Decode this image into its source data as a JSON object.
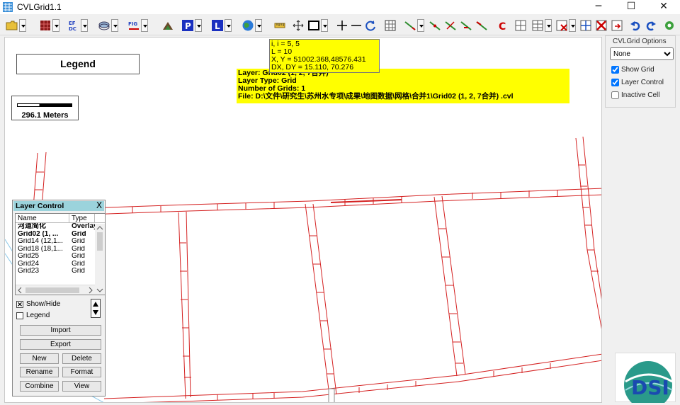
{
  "window": {
    "title": "CVLGrid1.1",
    "controls": {
      "minimize": "─",
      "maximize": "☐",
      "close": "✕"
    }
  },
  "toolbar": {
    "icons": [
      "open-folder-icon",
      "grid-icon",
      "ef-dc-icon",
      "layers-icon",
      "fig-icon",
      "hill-icon",
      "p-icon",
      "l-icon",
      "globe-icon",
      "ruler-icon",
      "pan-icon",
      "rectangle-icon",
      "add-icon",
      "minus-icon",
      "refresh-icon",
      "select-box-icon",
      "line-tool-1-icon",
      "line-tool-2-icon",
      "line-tool-3-icon",
      "line-tool-4-icon",
      "line-tool-5-icon",
      "c-icon",
      "grid-edit-1-icon",
      "grid-edit-2-icon",
      "grid-delete-icon",
      "grid-merge-icon",
      "grid-remove-icon",
      "grid-export-icon",
      "undo-icon",
      "redo-icon",
      "settings-icon"
    ]
  },
  "map": {
    "legend_title": "Legend",
    "scale_label": "296.1 Meters",
    "cursor_info": {
      "line1": "i, i = 5, 5",
      "line2": "L = 10",
      "line3": "X, Y = 51002.368,48576.431",
      "line4": "DX, DY = 15.110, 70.276"
    },
    "layer_info": {
      "line1": "Layer: Grid02 (1, 2, 7合并)",
      "line2": "Layer Type: Grid",
      "line3": "Number of Grids: 1",
      "line4": "File: D:\\文件\\研究生\\苏州水专项\\成果\\地图数据\\网格\\合并1\\Grid02 (1, 2, 7合并) .cvl"
    }
  },
  "layer_control": {
    "title": "Layer Control",
    "close_label": "X",
    "columns": [
      "Name",
      "Type"
    ],
    "rows": [
      {
        "name": "河道简化",
        "type": "Overlay",
        "bold": true
      },
      {
        "name": "Grid02 (1, ...",
        "type": "Grid",
        "bold": true
      },
      {
        "name": "Grid14 (12,1...",
        "type": "Grid",
        "bold": false
      },
      {
        "name": "Grid18 (18,1...",
        "type": "Grid",
        "bold": false
      },
      {
        "name": "Grid25",
        "type": "Grid",
        "bold": false
      },
      {
        "name": "Grid24",
        "type": "Grid",
        "bold": false
      },
      {
        "name": "Grid23",
        "type": "Grid",
        "bold": false
      }
    ],
    "show_hide_label": "Show/Hide",
    "show_hide_checked": "✕",
    "legend_label": "Legend",
    "buttons": {
      "import": "Import",
      "export": "Export",
      "new": "New",
      "delete": "Delete",
      "rename": "Rename",
      "format": "Format",
      "combine": "Combine",
      "view": "View"
    }
  },
  "options_panel": {
    "title": "CVLGrid Options",
    "select_value": "None",
    "show_grid_label": "Show Grid",
    "layer_control_label": "Layer Control",
    "inactive_cell_label": "Inactive Cell",
    "show_grid_checked": true,
    "layer_control_checked": true,
    "inactive_cell_checked": false
  },
  "logo": {
    "text": "DSI"
  },
  "colors": {
    "grid_line": "#d42020",
    "info_bg": "#ffff00",
    "layer_header": "#9bd3dc",
    "river_line": "#88c7e8"
  }
}
